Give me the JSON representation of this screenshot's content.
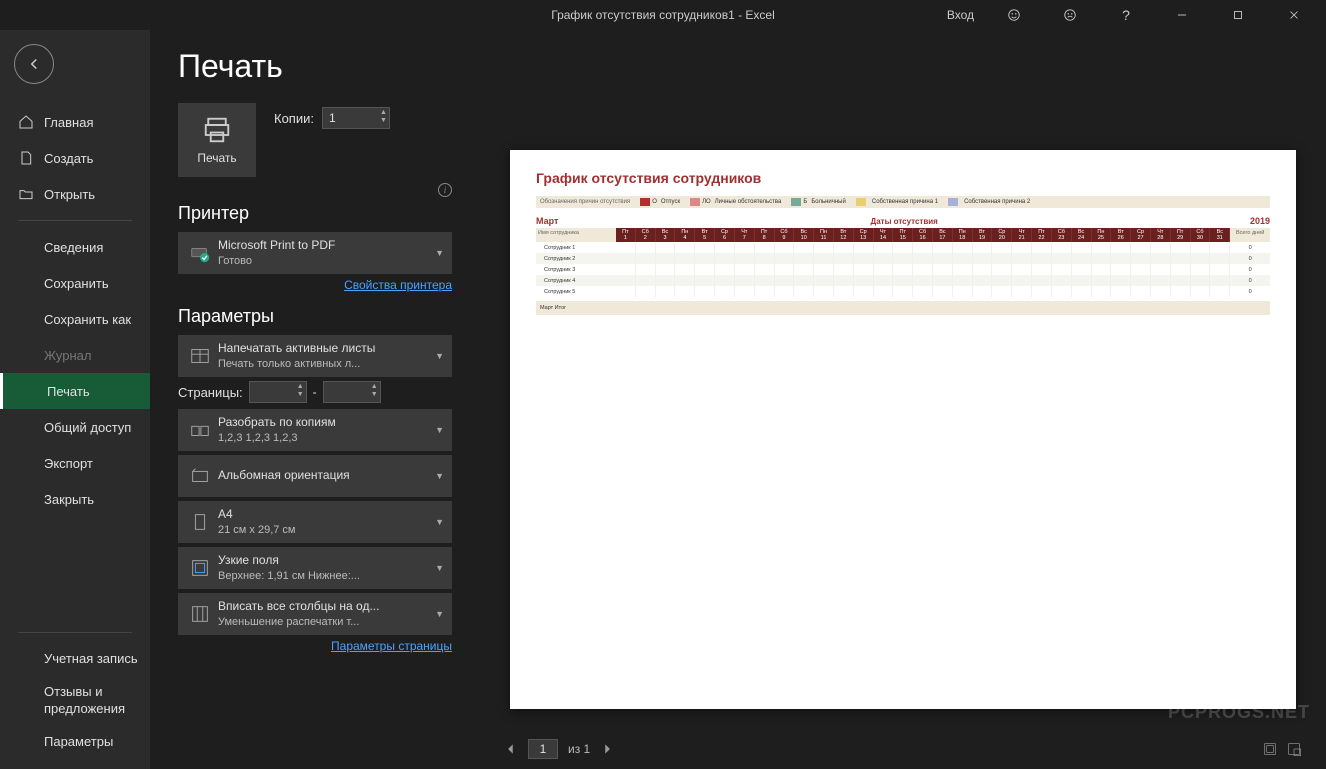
{
  "titlebar": {
    "title": "График отсутствия сотрудников1  -  Excel",
    "login": "Вход"
  },
  "sidebar": {
    "home": "Главная",
    "create": "Создать",
    "open": "Открыть",
    "info": "Сведения",
    "save": "Сохранить",
    "saveAs": "Сохранить как",
    "history": "Журнал",
    "print": "Печать",
    "share": "Общий доступ",
    "export": "Экспорт",
    "close": "Закрыть",
    "account": "Учетная запись",
    "feedback": "Отзывы и предложения",
    "options": "Параметры"
  },
  "settings": {
    "pageTitle": "Печать",
    "printBtn": "Печать",
    "copiesLabel": "Копии:",
    "copiesValue": "1",
    "printerSection": "Принтер",
    "printer": {
      "name": "Microsoft Print to PDF",
      "status": "Готово"
    },
    "printerProps": "Свойства принтера",
    "paramsSection": "Параметры",
    "activeSheets": {
      "l1": "Напечатать активные листы",
      "l2": "Печать только активных л..."
    },
    "pagesLabel": "Страницы:",
    "to": "-",
    "collate": {
      "l1": "Разобрать по копиям",
      "l2": "1,2,3    1,2,3    1,2,3"
    },
    "orientation": {
      "l1": "Альбомная ориентация"
    },
    "paper": {
      "l1": "A4",
      "l2": "21 см x 29,7 см"
    },
    "margins": {
      "l1": "Узкие поля",
      "l2": "Верхнее: 1,91 см Нижнее:..."
    },
    "scaling": {
      "l1": "Вписать все столбцы на од...",
      "l2": "Уменьшение распечатки т..."
    },
    "pageSetup": "Параметры страницы"
  },
  "preview": {
    "docTitle": "График отсутствия сотрудников",
    "legendLabel": "Обозначения причин отсутствия",
    "legend": [
      {
        "code": "О",
        "label": "Отпуск",
        "color": "#b03030"
      },
      {
        "code": "ЛО",
        "label": "Личные обстоятельства",
        "color": "#d88"
      },
      {
        "code": "Б",
        "label": "Больничный",
        "color": "#7a9"
      },
      {
        "code": "",
        "label": "Собственная причина 1",
        "color": "#e8d070"
      },
      {
        "code": "",
        "label": "Собственная причина 2",
        "color": "#a8b0d8"
      }
    ],
    "month": "Март",
    "midLabel": "Даты отсутствия",
    "year": "2019",
    "empHeader": "Имя сотрудника",
    "dayNames": [
      "Пт",
      "Сб",
      "Вс",
      "Пн",
      "Вт",
      "Ср",
      "Чт",
      "Пт",
      "Сб",
      "Вс",
      "Пн",
      "Вт",
      "Ср",
      "Чт",
      "Пт",
      "Сб",
      "Вс",
      "Пн",
      "Вт",
      "Ср",
      "Чт",
      "Пт",
      "Сб",
      "Вс",
      "Пн",
      "Вт",
      "Ср",
      "Чт",
      "Пт",
      "Сб",
      "Вс"
    ],
    "dayNums": [
      "1",
      "2",
      "3",
      "4",
      "5",
      "6",
      "7",
      "8",
      "9",
      "10",
      "11",
      "12",
      "13",
      "14",
      "15",
      "16",
      "17",
      "18",
      "19",
      "20",
      "21",
      "22",
      "23",
      "24",
      "25",
      "26",
      "27",
      "28",
      "29",
      "30",
      "31"
    ],
    "totalHeader": "Всего дней",
    "employees": [
      {
        "name": "Сотрудник 1",
        "total": "0"
      },
      {
        "name": "Сотрудник 2",
        "total": "0"
      },
      {
        "name": "Сотрудник 3",
        "total": "0"
      },
      {
        "name": "Сотрудник 4",
        "total": "0"
      },
      {
        "name": "Сотрудник 5",
        "total": "0"
      }
    ],
    "summary": "Март Итог"
  },
  "pageNav": {
    "current": "1",
    "of": "из 1"
  },
  "watermark": "PCPROGS.NET"
}
